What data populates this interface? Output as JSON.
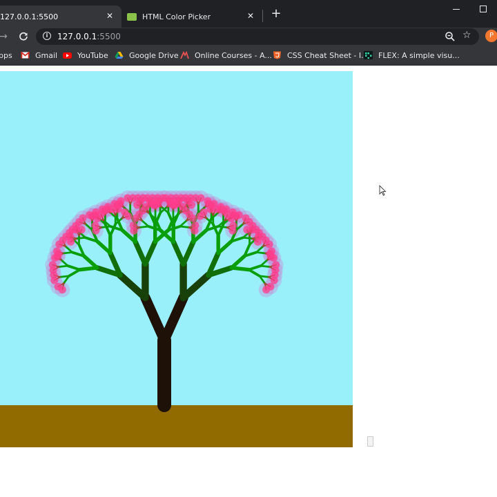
{
  "browser": {
    "tabs": [
      {
        "title": "127.0.0.1:5500",
        "active": true
      },
      {
        "title": "HTML Color Picker",
        "active": false,
        "favicon": "html-color-picker-icon"
      }
    ],
    "url": {
      "host": "127.0.0.1",
      "port": ":5500"
    },
    "profile_initial": "P",
    "bookmarks": [
      {
        "label": "pps",
        "icon": "apps-icon"
      },
      {
        "label": "Gmail",
        "icon": "gmail-icon"
      },
      {
        "label": "YouTube",
        "icon": "youtube-icon"
      },
      {
        "label": "Google Drive",
        "icon": "google-drive-icon"
      },
      {
        "label": "Online Courses - A...",
        "icon": "online-courses-icon"
      },
      {
        "label": "CSS Cheat Sheet - I...",
        "icon": "css-cheat-sheet-icon"
      },
      {
        "label": "FLEX: A simple visu...",
        "icon": "flex-icon"
      }
    ]
  },
  "scene": {
    "sky_color": "#9af0fa",
    "ground_color": "#926b00",
    "trunk_color": "#1e1208",
    "branch_color": "#0a9e0a",
    "blossom_color": "#ff3c8c",
    "blossom_glow_color": "#c882d2",
    "twig_color": "#a54632",
    "recursion_depth": 8
  }
}
